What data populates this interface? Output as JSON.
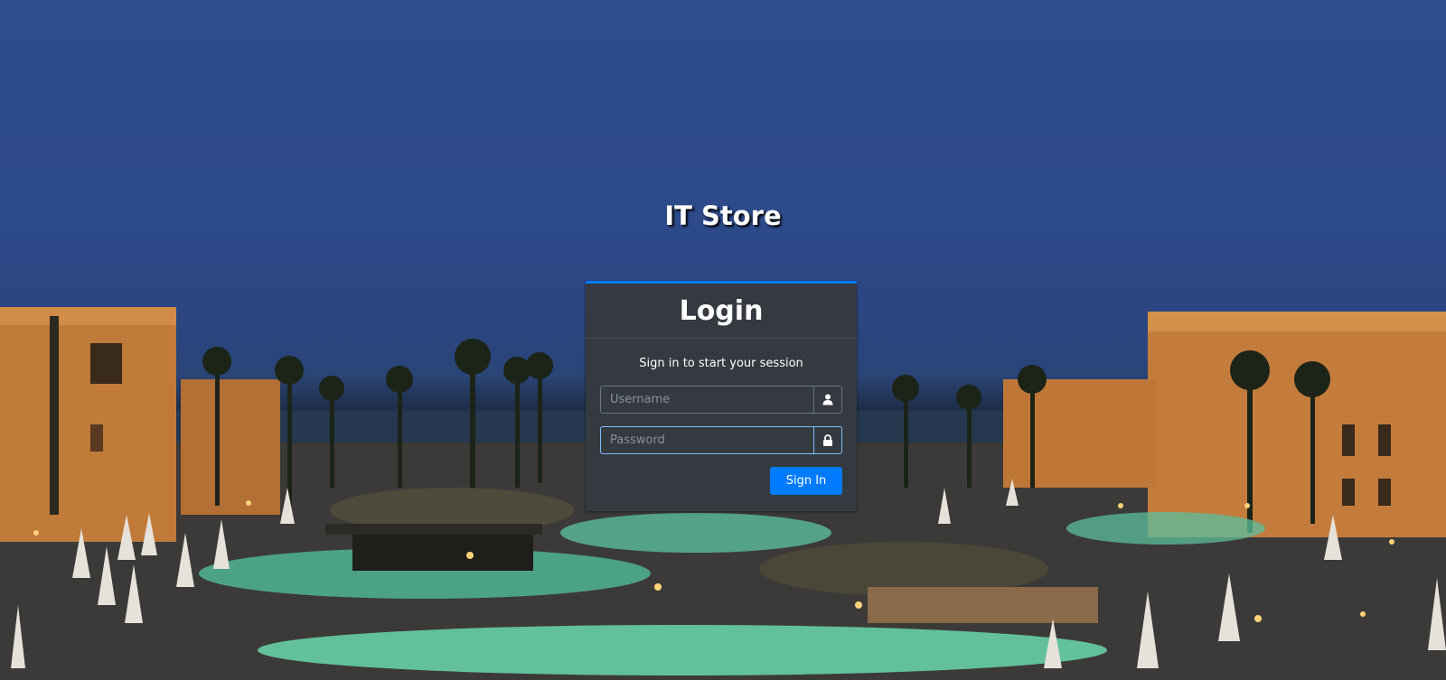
{
  "brand": {
    "title": "IT Store"
  },
  "login": {
    "title": "Login",
    "message": "Sign in to start your session",
    "username_placeholder": "Username",
    "password_placeholder": "Password",
    "submit_label": "Sign In"
  },
  "icons": {
    "username": "user-icon",
    "password": "lock-icon"
  },
  "colors": {
    "accent": "#007bff",
    "card_bg": "#343a40",
    "sky": "#2f4c8c"
  }
}
